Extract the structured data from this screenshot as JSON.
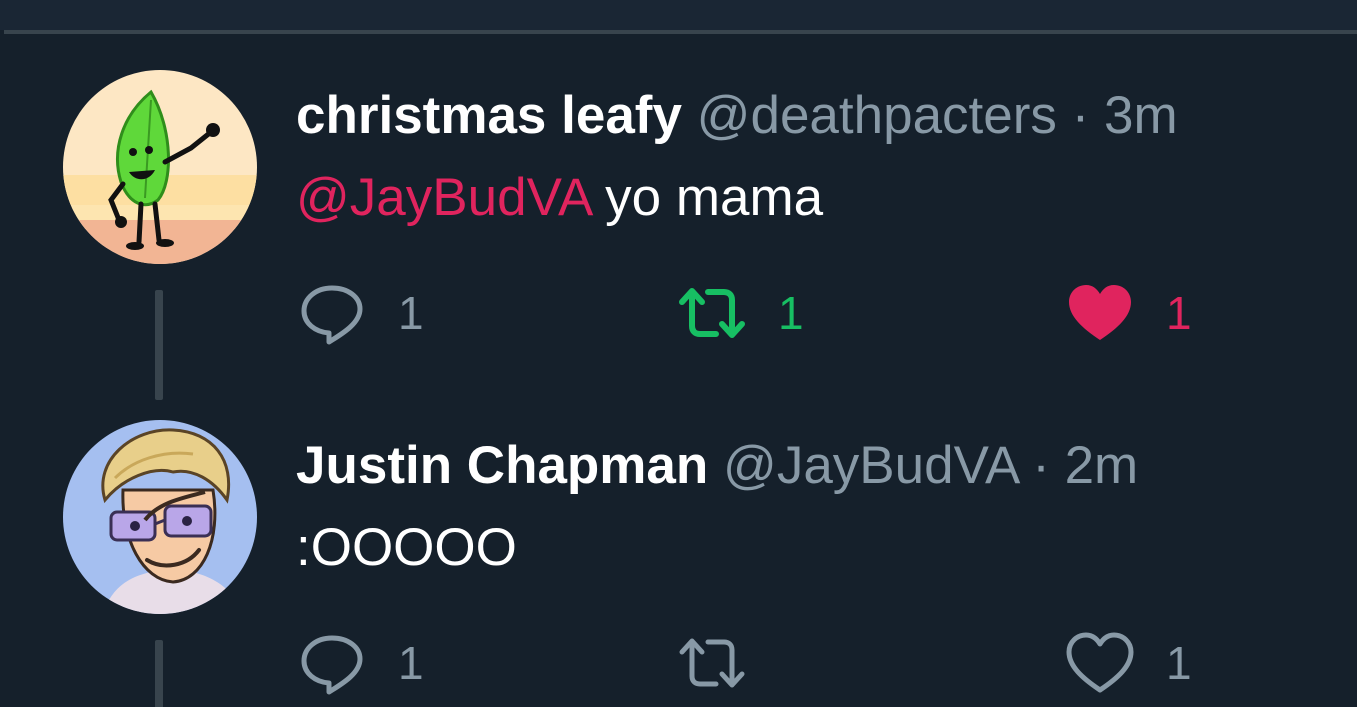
{
  "colors": {
    "background": "#15202b",
    "text": "#ffffff",
    "secondary_text": "#8899a6",
    "mention": "#e0245e",
    "retweet_active": "#17bf63",
    "like_active": "#e0245e",
    "divider": "#38444d"
  },
  "tweets": [
    {
      "display_name": "christmas leafy",
      "handle": "@deathpacters",
      "separator": "·",
      "time": "3m",
      "mention": "@JayBudVA",
      "text": " yo mama",
      "avatar": "leaf-character-avatar",
      "reply_count": "1",
      "retweet_count": "1",
      "like_count": "1",
      "retweeted": true,
      "liked": true
    },
    {
      "display_name": "Justin Chapman",
      "handle": "@JayBudVA",
      "separator": "·",
      "time": "2m",
      "mention": "",
      "text": ":OOOOO",
      "avatar": "cartoon-man-avatar",
      "reply_count": "1",
      "retweet_count": "",
      "like_count": "1",
      "retweeted": false,
      "liked": false
    }
  ]
}
